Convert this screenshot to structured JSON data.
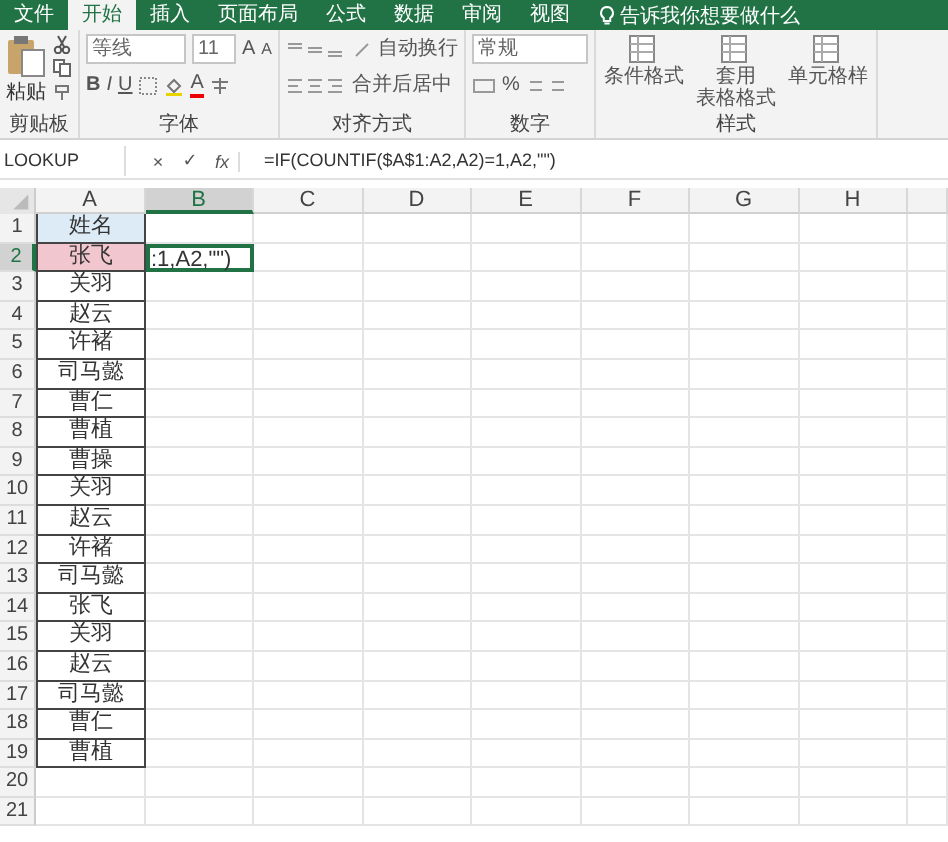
{
  "tabs": [
    {
      "label": "文件",
      "selected": false
    },
    {
      "label": "开始",
      "selected": true
    },
    {
      "label": "插入",
      "selected": false
    },
    {
      "label": "页面布局",
      "selected": false
    },
    {
      "label": "公式",
      "selected": false
    },
    {
      "label": "数据",
      "selected": false
    },
    {
      "label": "审阅",
      "selected": false
    },
    {
      "label": "视图",
      "selected": false
    }
  ],
  "tell_me": "告诉我你想要做什么",
  "clipboard": {
    "paste": "粘贴",
    "label": "剪贴板"
  },
  "font": {
    "name": "等线",
    "size": "11",
    "grow": "A",
    "shrink": "A",
    "bold": "B",
    "italic": "I",
    "underline": "U",
    "color_button": "A",
    "label": "字体"
  },
  "alignment": {
    "wrap": "自动换行",
    "merge": "合并后居中",
    "label": "对齐方式"
  },
  "number": {
    "format": "常规",
    "percent": "%",
    "label": "数字"
  },
  "styles": {
    "items": [
      {
        "lines": [
          "条件格式"
        ]
      },
      {
        "lines": [
          "套用",
          "表格格式"
        ]
      },
      {
        "lines": [
          "单元格样"
        ]
      }
    ],
    "label": "样式"
  },
  "formula_bar": {
    "name_box": "LOOKUP",
    "cancel": "×",
    "enter": "✓",
    "fx": "fx",
    "formula": "=IF(COUNTIF($A$1:A2,A2)=1,A2,\"\")"
  },
  "columns": [
    {
      "label": "A",
      "selected": false
    },
    {
      "label": "B",
      "selected": true
    },
    {
      "label": "C",
      "selected": false
    },
    {
      "label": "D",
      "selected": false
    },
    {
      "label": "E",
      "selected": false
    },
    {
      "label": "F",
      "selected": false
    },
    {
      "label": "G",
      "selected": false
    },
    {
      "label": "H",
      "selected": false
    }
  ],
  "rows": [
    {
      "number": "1",
      "selected": false,
      "a": "姓名",
      "color": "#ddebf7"
    },
    {
      "number": "2",
      "selected": true,
      "a": "张飞",
      "color": "#f2c6cf",
      "b": ":1,A2,\"\")"
    },
    {
      "number": "3",
      "selected": false,
      "a": "关羽"
    },
    {
      "number": "4",
      "selected": false,
      "a": "赵云"
    },
    {
      "number": "5",
      "selected": false,
      "a": "许褚"
    },
    {
      "number": "6",
      "selected": false,
      "a": "司马懿"
    },
    {
      "number": "7",
      "selected": false,
      "a": "曹仁"
    },
    {
      "number": "8",
      "selected": false,
      "a": "曹植"
    },
    {
      "number": "9",
      "selected": false,
      "a": "曹操"
    },
    {
      "number": "10",
      "selected": false,
      "a": "关羽"
    },
    {
      "number": "11",
      "selected": false,
      "a": "赵云"
    },
    {
      "number": "12",
      "selected": false,
      "a": "许褚"
    },
    {
      "number": "13",
      "selected": false,
      "a": "司马懿"
    },
    {
      "number": "14",
      "selected": false,
      "a": "张飞"
    },
    {
      "number": "15",
      "selected": false,
      "a": "关羽"
    },
    {
      "number": "16",
      "selected": false,
      "a": "赵云"
    },
    {
      "number": "17",
      "selected": false,
      "a": "司马懿"
    },
    {
      "number": "18",
      "selected": false,
      "a": "曹仁"
    },
    {
      "number": "19",
      "selected": false,
      "a": "曹植"
    },
    {
      "number": "20",
      "selected": false
    },
    {
      "number": "21",
      "selected": false
    }
  ]
}
